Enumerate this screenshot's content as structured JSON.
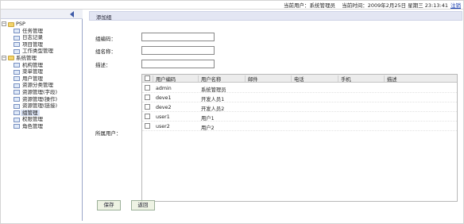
{
  "topbar": {
    "current_user": "当前用户：系统管理员",
    "current_time": "当前时间：2009年2月25日 星期三 23:13:41",
    "logout": "注销"
  },
  "tree": [
    {
      "label": "PSP",
      "level": 1,
      "expander": "−"
    },
    {
      "label": "任务管理",
      "level": 2
    },
    {
      "label": "日志记录",
      "level": 2
    },
    {
      "label": "项目管理",
      "level": 2
    },
    {
      "label": "工作类型管理",
      "level": 2
    },
    {
      "label": "系统管理",
      "level": 1,
      "expander": "−"
    },
    {
      "label": "机构管理",
      "level": 2
    },
    {
      "label": "菜单管理",
      "level": 2
    },
    {
      "label": "用户管理",
      "level": 2
    },
    {
      "label": "资源分类管理",
      "level": 2
    },
    {
      "label": "资源管理(字段)",
      "level": 2
    },
    {
      "label": "资源管理(操作)",
      "level": 2
    },
    {
      "label": "资源管理(链接)",
      "level": 2
    },
    {
      "label": "组管理",
      "level": 2,
      "selected": true
    },
    {
      "label": "权限管理",
      "level": 2
    },
    {
      "label": "角色管理",
      "level": 2
    }
  ],
  "main": {
    "header_title": "添加组",
    "form": {
      "group_code_label": "组编码：",
      "group_name_label": "组名称：",
      "description_label": "描述：",
      "users_label": "所属用户："
    },
    "table": {
      "headers": [
        "用户编码",
        "用户名称",
        "邮件",
        "电话",
        "手机",
        "描述"
      ],
      "rows": [
        {
          "code": "admin",
          "name": "系统管理员"
        },
        {
          "code": "deve1",
          "name": "开发人员1"
        },
        {
          "code": "deve2",
          "name": "开发人员2"
        },
        {
          "code": "user1",
          "name": "用户1"
        },
        {
          "code": "user2",
          "name": "用户2"
        }
      ]
    },
    "buttons": {
      "save": "保存",
      "back": "返回"
    }
  }
}
